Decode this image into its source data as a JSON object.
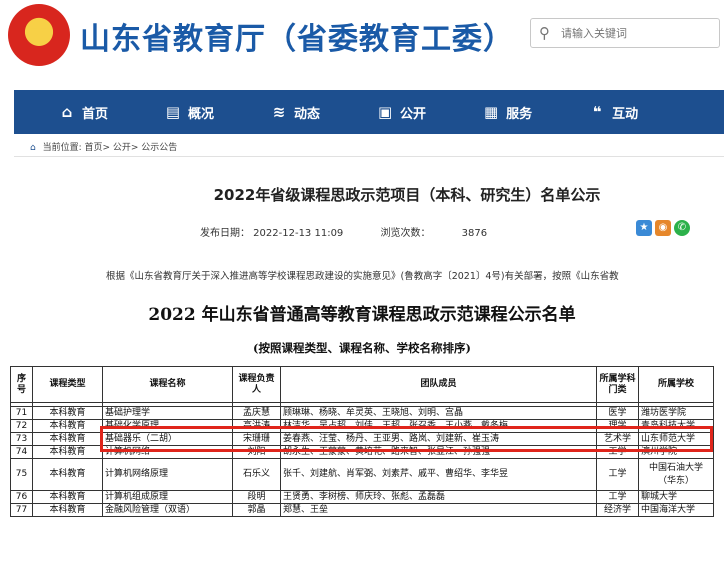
{
  "header": {
    "site_title": "山东省教育厅（省委教育工委）",
    "search_placeholder": "请输入关键词"
  },
  "nav": [
    {
      "label": "首页",
      "icon": "home-icon"
    },
    {
      "label": "概况",
      "icon": "overview-icon"
    },
    {
      "label": "动态",
      "icon": "news-icon"
    },
    {
      "label": "公开",
      "icon": "open-icon"
    },
    {
      "label": "服务",
      "icon": "service-icon"
    },
    {
      "label": "互动",
      "icon": "chat-icon"
    }
  ],
  "breadcrumb": "当前位置: 首页> 公开> 公示公告",
  "article": {
    "title": "2022年省级课程思政示范项目（本科、研究生）名单公示",
    "publish_date": "发布日期： 2022-12-13 11:09",
    "views_label": "浏览次数：",
    "views": "3876",
    "intro": "根据《山东省教育厅关于深入推进高等学校课程思政建设的实施意见》(鲁教高字〔2021〕4号)有关部署，按照《山东省教"
  },
  "document": {
    "title": "2022 年山东省普通高等教育课程思政示范课程公示名单",
    "subtitle": "(按照课程类型、课程名称、学校名称排序)",
    "headers": [
      "序号",
      "课程类型",
      "课程名称",
      "课程负责人",
      "团队成员",
      "所属学科门类",
      "所属学校"
    ],
    "rows": [
      [
        "71",
        "本科教育",
        "基础护理学",
        "孟庆慧",
        "顾琳琳、杨晓、牟灵英、王晓旭、刘明、宫晶",
        "医学",
        "潍坊医学院"
      ],
      [
        "72",
        "本科教育",
        "基础化学原理",
        "高洪涛",
        "林洁华、吴占超、刘佳、王超、张召香、王小燕、戴冬梅",
        "理学",
        "青岛科技大学"
      ],
      [
        "73",
        "本科教育",
        "基础器乐（二胡）",
        "宋珊珊",
        "姜春燕、汪莹、杨丹、王亚男、路岚、刘建新、崔玉涛",
        "艺术学",
        "山东师范大学"
      ],
      [
        "74",
        "本科教育",
        "计算机网络",
        "刘阳",
        "胡永生、王蒙蒙、黄培花、路来智、张显江、孙强强",
        "工学",
        "滨州学院"
      ],
      [
        "75",
        "本科教育",
        "计算机网络原理",
        "石乐义",
        "张千、刘建航、肖军弼、刘素芹、戚平、曹绍华、李华昱",
        "工学",
        "中国石油大学（华东）"
      ],
      [
        "76",
        "本科教育",
        "计算机组成原理",
        "段明",
        "王贤勇、李树榜、师庆玲、张彪、孟磊磊",
        "工学",
        "聊城大学"
      ],
      [
        "77",
        "本科教育",
        "金融风险管理（双语）",
        "郭晶",
        "郑慧、王垒",
        "经济学",
        "中国海洋大学"
      ]
    ]
  },
  "colors": {
    "brand_blue": "#1a5aa7",
    "nav_bg": "#1d4f8f",
    "highlight_red": "#e0251b"
  }
}
